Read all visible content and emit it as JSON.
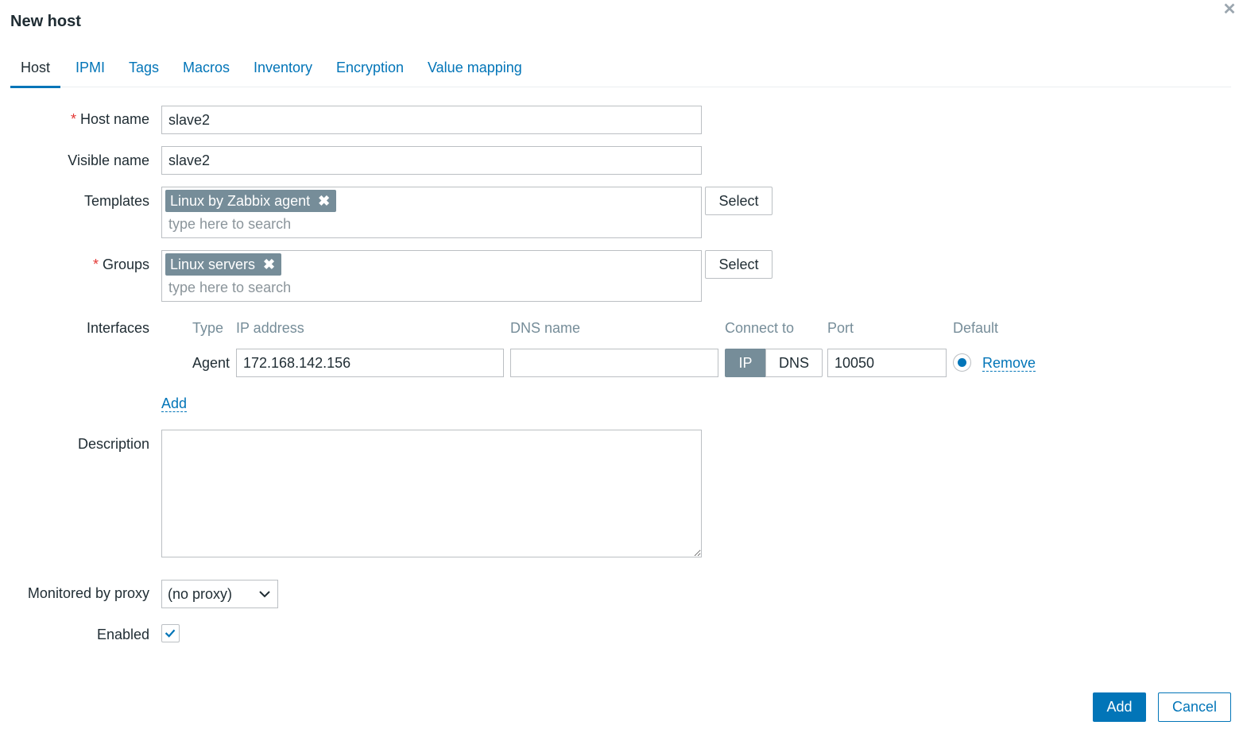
{
  "dialog": {
    "title": "New host",
    "close_icon": "close-icon"
  },
  "tabs": [
    {
      "label": "Host",
      "active": true
    },
    {
      "label": "IPMI"
    },
    {
      "label": "Tags"
    },
    {
      "label": "Macros"
    },
    {
      "label": "Inventory"
    },
    {
      "label": "Encryption"
    },
    {
      "label": "Value mapping"
    }
  ],
  "form": {
    "host_name": {
      "label": "Host name",
      "required_mark": "*",
      "value": "slave2"
    },
    "visible_name": {
      "label": "Visible name",
      "value": "slave2"
    },
    "templates": {
      "label": "Templates",
      "chip": "Linux by Zabbix agent",
      "placeholder": "type here to search",
      "select_label": "Select"
    },
    "groups": {
      "label": "Groups",
      "required_mark": "*",
      "chip": "Linux servers",
      "placeholder": "type here to search",
      "select_label": "Select"
    },
    "interfaces": {
      "label": "Interfaces",
      "headers": {
        "type": "Type",
        "ip": "IP address",
        "dns": "DNS name",
        "connect": "Connect to",
        "port": "Port",
        "default": "Default"
      },
      "row": {
        "type": "Agent",
        "ip": "172.168.142.156",
        "dns": "",
        "connect_ip": "IP",
        "connect_dns": "DNS",
        "connect_selected": "IP",
        "port": "10050",
        "default_selected": true,
        "remove_label": "Remove"
      },
      "add_label": "Add"
    },
    "description": {
      "label": "Description",
      "value": ""
    },
    "proxy": {
      "label": "Monitored by proxy",
      "value": "(no proxy)"
    },
    "enabled": {
      "label": "Enabled",
      "checked": true
    }
  },
  "footer": {
    "add_label": "Add",
    "cancel_label": "Cancel"
  },
  "colors": {
    "accent": "#0275b8",
    "chip": "#768d99",
    "required": "#e33734"
  }
}
